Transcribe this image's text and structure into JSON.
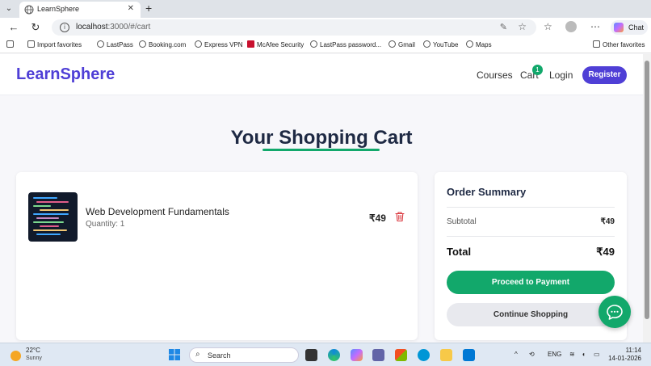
{
  "browser": {
    "tab_title": "LearnSphere",
    "tab_close": "✕",
    "new_tab": "+",
    "url_host": "localhost",
    "url_rest": ":3000/#/cart",
    "chat_label": "Chat",
    "bookmarks": [
      "Import favorites",
      "LastPass",
      "Booking.com",
      "Express VPN",
      "McAfee Security",
      "LastPass password...",
      "Gmail",
      "YouTube",
      "Maps"
    ],
    "other_favorites": "Other favorites"
  },
  "header": {
    "brand": "LearnSphere",
    "nav": {
      "courses": "Courses",
      "cart": "Cart",
      "login": "Login",
      "register": "Register"
    },
    "cart_count": "1"
  },
  "cart": {
    "title": "Your Shopping Cart",
    "items": [
      {
        "title": "Web Development Fundamentals",
        "quantity": "Quantity: 1",
        "price": "₹49"
      }
    ]
  },
  "summary": {
    "title": "Order Summary",
    "subtotal_label": "Subtotal",
    "subtotal_value": "₹49",
    "total_label": "Total",
    "total_value": "₹49",
    "pay_button": "Proceed to Payment",
    "continue_button": "Continue Shopping"
  },
  "taskbar": {
    "temperature": "22°C",
    "condition": "Sunny",
    "search_placeholder": "Search",
    "language": "ENG",
    "time": "11:14",
    "date": "14-01-2026"
  },
  "colors": {
    "brand": "#4f3fd6",
    "accent_green": "#12a86b",
    "trash_red": "#d9343b"
  }
}
